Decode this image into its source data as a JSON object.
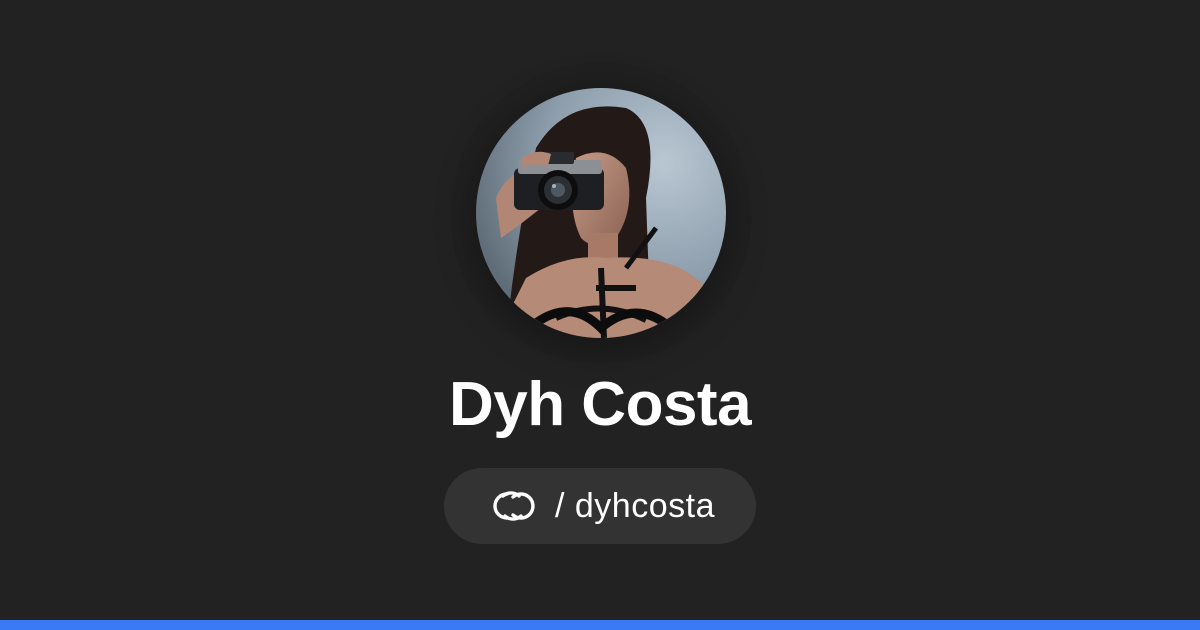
{
  "profile": {
    "name": "Dyh Costa",
    "handle": "/ dyhcosta",
    "avatar_alt": "profile-photo"
  },
  "colors": {
    "background": "#222223",
    "pill_background": "#333334",
    "text": "#ffffff",
    "accent_bar": "#3a7bf5"
  },
  "icons": {
    "brand": "linked-rings-icon"
  }
}
